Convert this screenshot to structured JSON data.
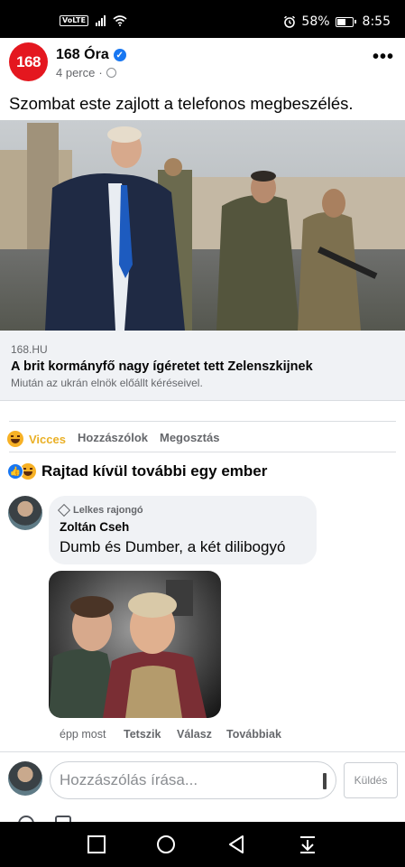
{
  "status_bar": {
    "network": "VoLTE",
    "alarm_icon": "alarm-icon",
    "battery_percent": "58%",
    "battery_level": 0.58,
    "time": "8:55"
  },
  "post": {
    "page_logo_text": "168",
    "page_name": "168 Óra",
    "time": "4 perce",
    "text": "Szombat este zajlott a telefonos megbeszélés.",
    "link": {
      "domain": "168.HU",
      "title": "A brit kormányfő nagy ígéretet tett Zelenszkijnek",
      "description": "Miután az ukrán elnök előállt kéréseivel."
    },
    "actions": {
      "reaction_label": "Vicces",
      "comment_label": "Hozzászólok",
      "share_label": "Megosztás"
    },
    "reactions_summary": "Rajtad kívül további egy ember"
  },
  "comment": {
    "badge": "Lelkes rajongó",
    "author": "Zoltán Cseh",
    "text": "Dumb és Dumber, a két dilibogyó",
    "time": "épp most",
    "like_label": "Tetszik",
    "reply_label": "Válasz",
    "more_label": "Továbbiak"
  },
  "composer": {
    "placeholder": "Hozzászólás írása...",
    "send_label": "Küldés"
  },
  "colors": {
    "brand_red": "#e4171f",
    "facebook_blue": "#1877f2",
    "haha_yellow": "#f7b125",
    "secondary_text": "#65676b"
  }
}
